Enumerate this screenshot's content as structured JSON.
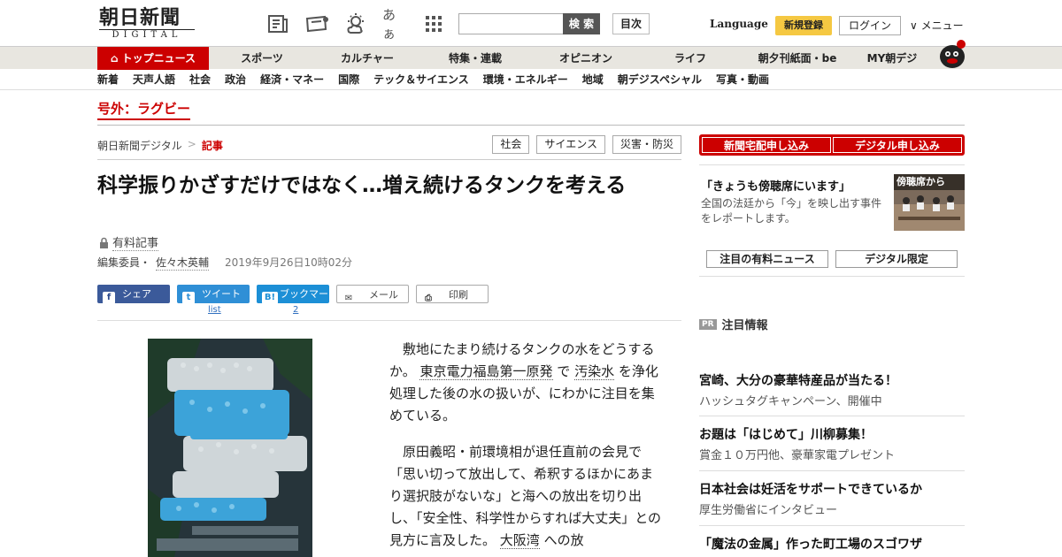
{
  "header": {
    "logo_main": "朝日新聞",
    "logo_sub": "DIGITAL",
    "search_button": "検 索",
    "toc_button": "目次",
    "language": "Language",
    "register": "新規登録",
    "login": "ログイン",
    "menu": "∨ メニュー",
    "icons": [
      "newspaper-icon",
      "ticket-icon",
      "weather-icon",
      "font-size-icon",
      "grid-icon"
    ],
    "font_size_label": "あぁ"
  },
  "nav_main": [
    "トップニュース",
    "スポーツ",
    "カルチャー",
    "特集・連載",
    "オピニオン",
    "ライフ",
    "朝夕刊紙面・be",
    "MY朝デジ"
  ],
  "nav_sub": [
    "新着",
    "天声人語",
    "社会",
    "政治",
    "経済・マネー",
    "国際",
    "テック＆サイエンス",
    "環境・エネルギー",
    "地域",
    "朝デジスペシャル",
    "写真・動画"
  ],
  "breaking": "号外：ラグビー",
  "breadcrumb": {
    "site": "朝日新聞デジタル",
    "sep": ">",
    "current": "記事"
  },
  "tags": [
    "社会",
    "サイエンス",
    "災害・防災"
  ],
  "article": {
    "title": "科学振りかざすだけではなく…増え続けるタンクを考える",
    "paid_label": "有料記事",
    "byline_role": "編集委員・",
    "author": "佐々木英輔",
    "date": "2019年9月26日10時02分",
    "p1_a": "敷地にたまり続けるタンクの水をどうするか。",
    "p1_link1": "東京電力福島第一原発",
    "p1_b": "で",
    "p1_link2": "汚染水",
    "p1_c": "を浄化処理した後の水の扱いが、にわかに注目を集めている。",
    "p2_a": "原田義昭・前環境相が退任直前の会見で「思い切って放出して、希釈するほかにあまり選択肢がないな」と海への放出を切り出し、「安全性、科学性からすれば大丈夫」との見方に言及した。",
    "p2_link": "大阪湾",
    "p2_b": "への放"
  },
  "share": {
    "facebook": "シェア",
    "twitter": "ツイート",
    "hatena": "ブックマーク",
    "mail": "メール",
    "print": "印刷",
    "twitter_sub": "list",
    "hatena_sub": "2"
  },
  "sidebar": {
    "subscribe_paper": "新聞宅配申し込み",
    "subscribe_digital": "デジタル申し込み",
    "promo_title": "「きょうも傍聴席にいます」",
    "promo_text": "全国の法廷から「今」を映し出す事件をレポートします。",
    "promo_image_caption": "傍聴席から",
    "btn_paid_news": "注目の有料ニュース",
    "btn_digital_limited": "デジタル限定",
    "pr_badge": "PR",
    "pr_heading": "注目情報",
    "pr_items": [
      {
        "title": "宮崎、大分の豪華特産品が当たる！",
        "sub": "ハッシュタグキャンペーン、開催中"
      },
      {
        "title": "お題は「はじめて」川柳募集！",
        "sub": "賞金１０万円他、豪華家電プレゼント"
      },
      {
        "title": "日本社会は妊活をサポートできているか",
        "sub": "厚生労働省にインタビュー"
      },
      {
        "title": "「魔法の金属」作った町工場のスゴワザ",
        "sub": ""
      }
    ]
  },
  "colors": {
    "brand_red": "#cc0000",
    "facebook": "#3b5a9a",
    "twitter": "#2f8fd6",
    "register_yellow": "#f5c842"
  }
}
